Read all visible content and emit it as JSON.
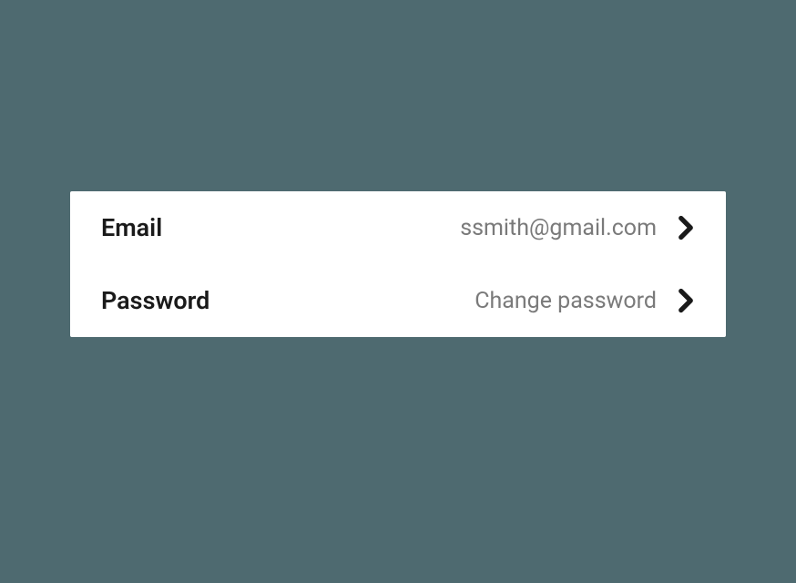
{
  "settings": {
    "rows": [
      {
        "label": "Email",
        "value": "ssmith@gmail.com"
      },
      {
        "label": "Password",
        "value": "Change password"
      }
    ]
  }
}
